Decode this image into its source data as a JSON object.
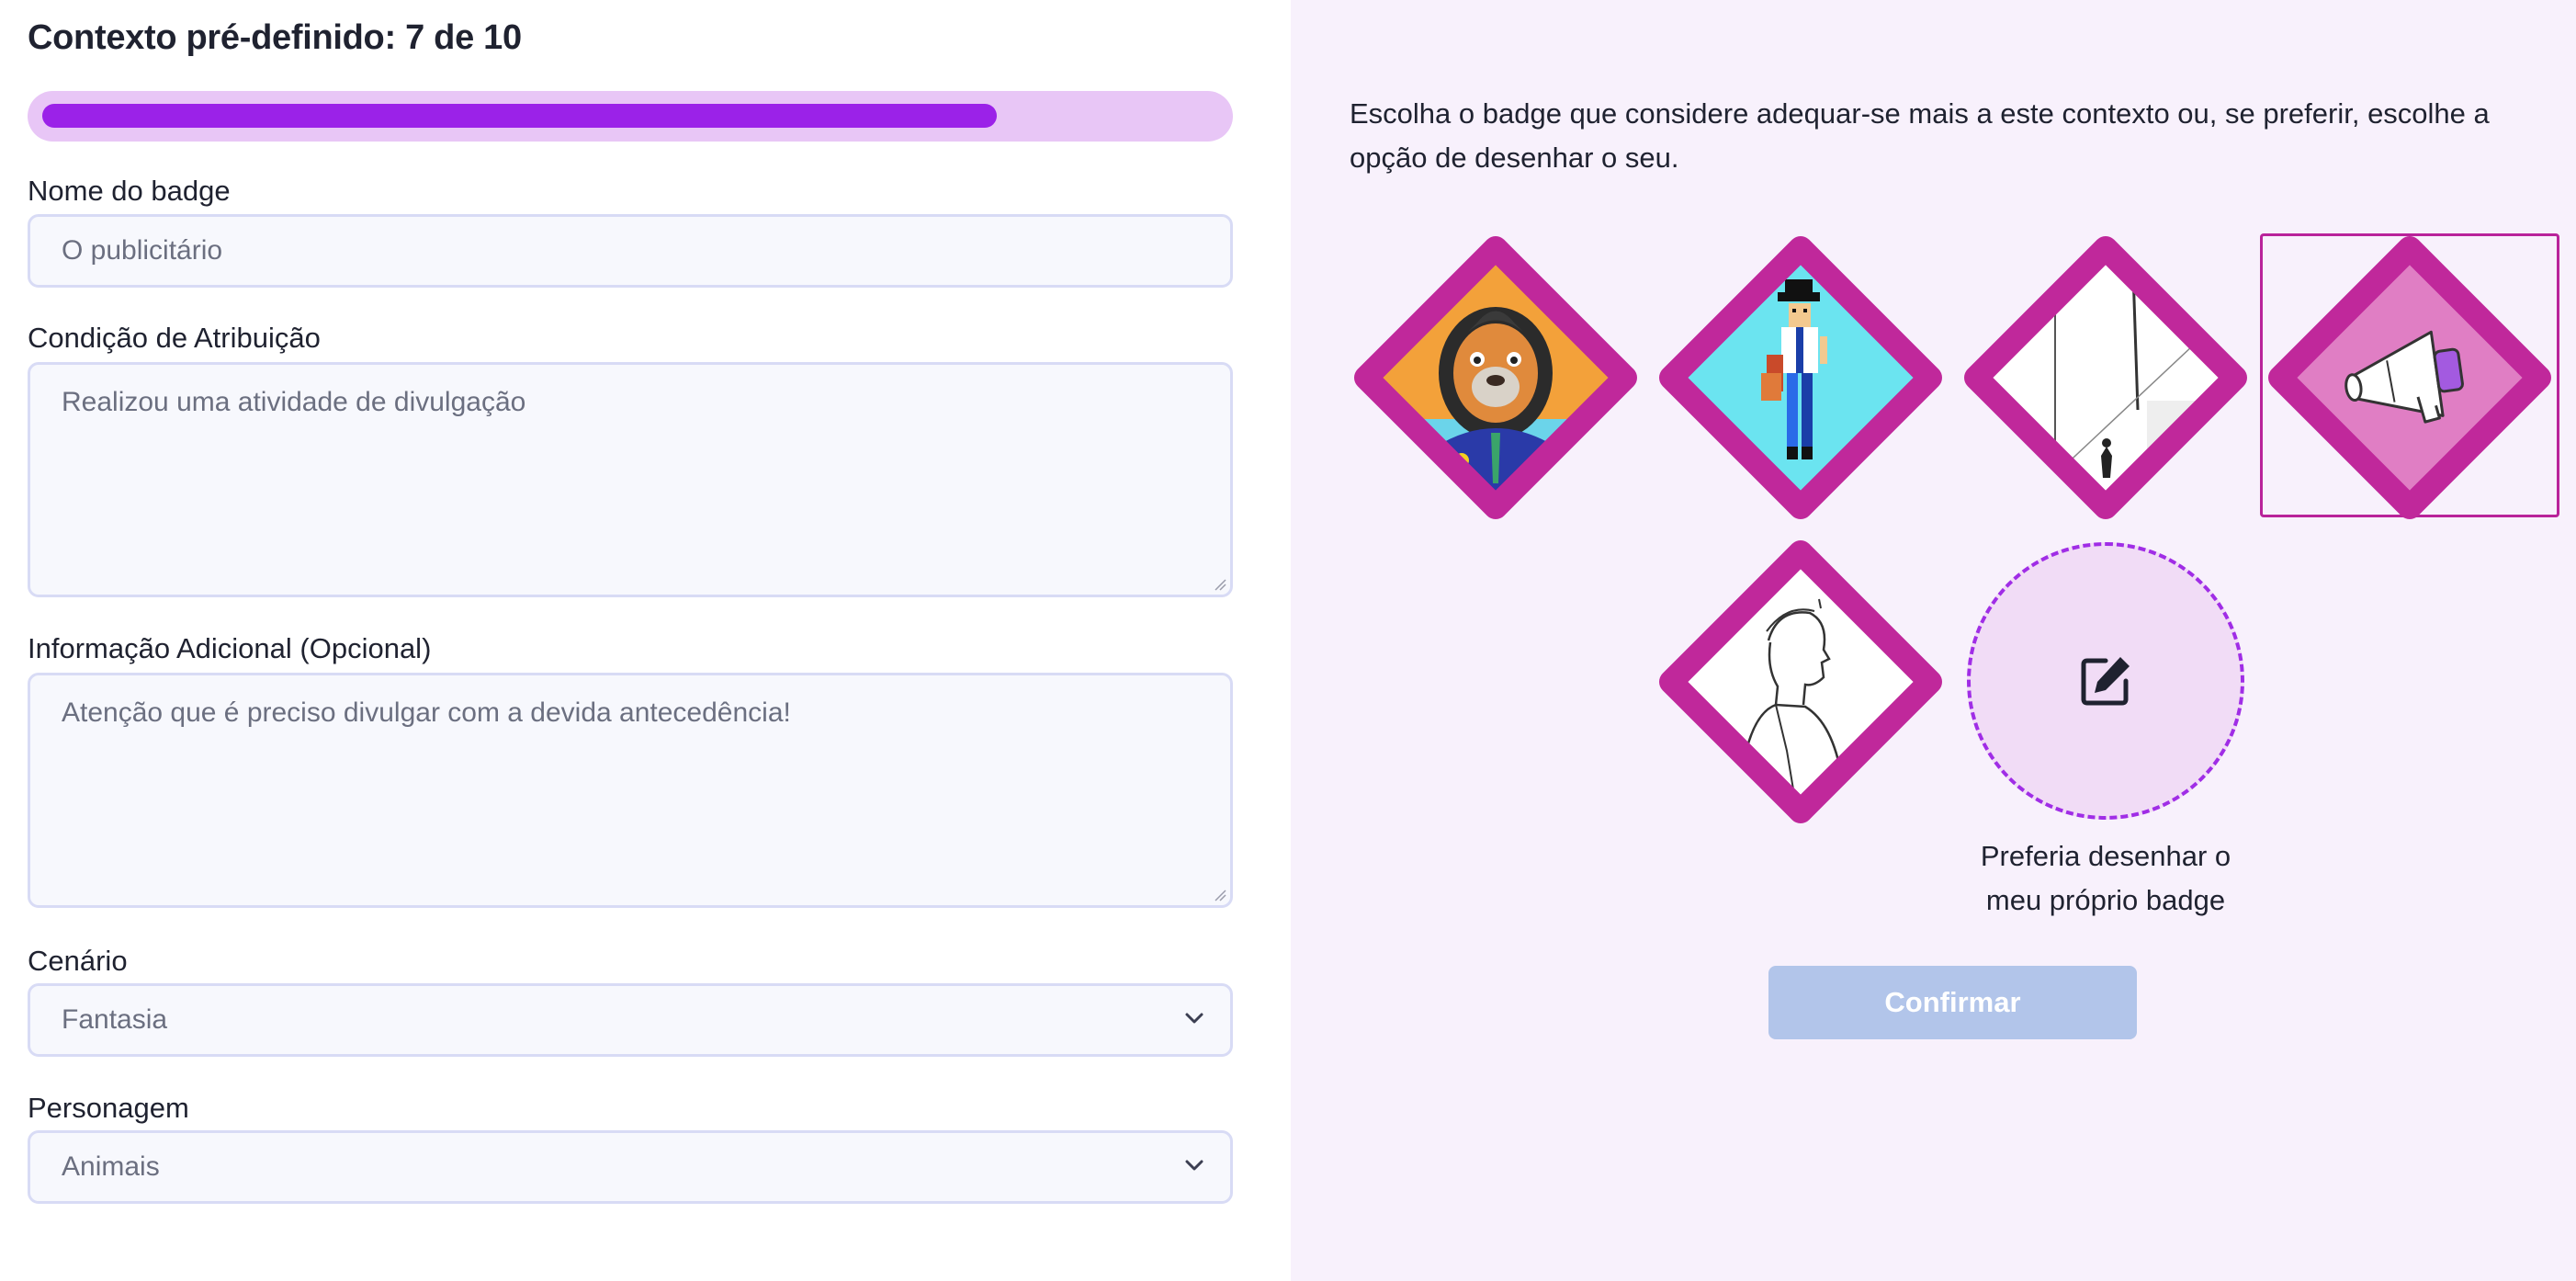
{
  "form": {
    "title": "Contexto pré-definido: 7 de 10",
    "progress": {
      "current": 7,
      "total": 10,
      "fraction": 0.7
    },
    "badge_name": {
      "label": "Nome do badge",
      "placeholder": "O publicitário"
    },
    "condition": {
      "label": "Condição de Atribuição",
      "placeholder": "Realizou uma atividade de divulgação"
    },
    "extra_info": {
      "label": "Informação Adicional (Opcional)",
      "placeholder": "Atenção que é preciso divulgar com a devida antecedência!"
    },
    "scenario": {
      "label": "Cenário",
      "value": "Fantasia"
    },
    "character": {
      "label": "Personagem",
      "value": "Animais"
    }
  },
  "badges": {
    "instructions": "Escolha o badge que considere adequar-se mais a este contexto ou, se preferir, escolhe a opção de desenhar o seu.",
    "options": [
      {
        "icon": "lion-businessman-image",
        "selected": false
      },
      {
        "icon": "pixel-character-image",
        "selected": false
      },
      {
        "icon": "wall-sketch-image",
        "selected": false
      },
      {
        "icon": "megaphone-icon",
        "selected": true
      },
      {
        "icon": "man-profile-sketch-image",
        "selected": false
      }
    ],
    "draw_own": {
      "icon": "edit-icon",
      "caption_line1": "Preferia desenhar o",
      "caption_line2": "meu próprio badge"
    },
    "confirm_label": "Confirmar"
  },
  "colors": {
    "accent": "#9b22e8",
    "badge_frame": "#c0289b",
    "confirm_disabled": "#b2c5ea",
    "right_panel_bg": "#f8f1fc"
  }
}
